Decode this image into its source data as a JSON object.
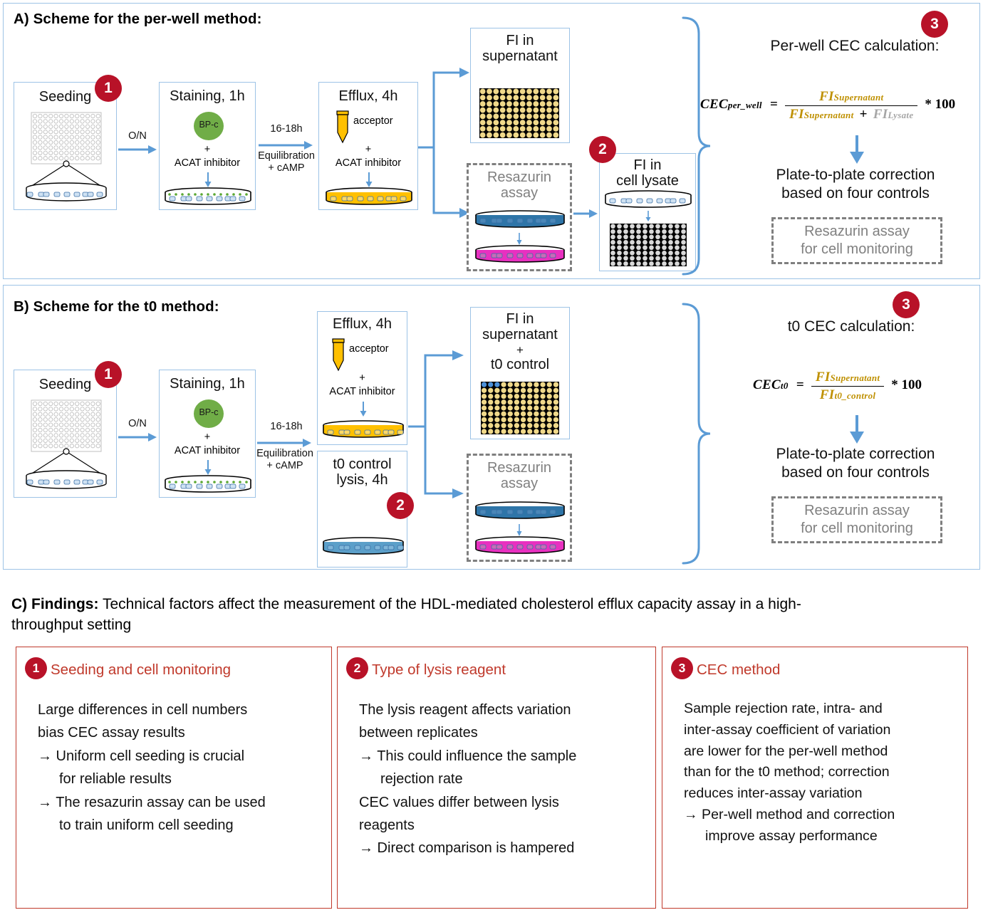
{
  "panelA": {
    "title": "A) Scheme for the per-well method:",
    "badges": {
      "one": "1",
      "two": "2",
      "three": "3"
    },
    "steps": [
      {
        "label": "Seeding",
        "icon": "96-well-plate-and-dish"
      },
      {
        "label": "Staining, 1h",
        "reagent": "BP-c",
        "plus": "+",
        "inhibitor": "ACAT inhibitor"
      },
      {
        "label": "Efflux, 4h",
        "reagent": "acceptor",
        "plus": "+",
        "inhibitor": "ACAT inhibitor"
      }
    ],
    "arrows": [
      {
        "label": "O/N"
      },
      {
        "label_line1": "16-18h",
        "label_line2": "Equilibration",
        "label_line3": "+ cAMP"
      }
    ],
    "outputs": [
      {
        "label_line1": "FI in",
        "label_line2": "supernatant",
        "icon": "yellow-microplate"
      },
      {
        "label_line1": "Resazurin",
        "label_line2": "assay",
        "style": "dashed-gray"
      },
      {
        "label_line1": "FI in",
        "label_line2": "cell lysate",
        "icon": "gray-microplate"
      }
    ],
    "calc": {
      "title": "Per-well CEC calculation:",
      "lhs": "CEC",
      "lhs_sub": "per_well",
      "eq": "=",
      "numerator": "FI",
      "numerator_sub": "Supernatant",
      "denominator_a": "FI",
      "denominator_a_sub": "Supernatant",
      "denominator_plus": "+",
      "denominator_b": "FI",
      "denominator_b_sub": "Lysate",
      "multiplier": "* 100"
    },
    "correction_line1": "Plate-to-plate correction",
    "correction_line2": "based on four controls",
    "resazurin_note_line1": "Resazurin assay",
    "resazurin_note_line2": "for cell monitoring"
  },
  "panelB": {
    "title": "B) Scheme for the t0 method:",
    "badges": {
      "one": "1",
      "two": "2",
      "three": "3"
    },
    "steps": [
      {
        "label": "Seeding",
        "icon": "96-well-plate-and-dish"
      },
      {
        "label": "Staining, 1h",
        "reagent": "BP-c",
        "plus": "+",
        "inhibitor": "ACAT inhibitor"
      },
      {
        "label": "Efflux, 4h",
        "reagent": "acceptor",
        "plus": "+",
        "inhibitor": "ACAT inhibitor"
      },
      {
        "label_line1": "t0 control",
        "label_line2": "lysis, 4h"
      }
    ],
    "arrows": [
      {
        "label": "O/N"
      },
      {
        "label_line1": "16-18h",
        "label_line2": "Equilibration",
        "label_line3": "+ cAMP"
      }
    ],
    "outputs": [
      {
        "label_line1": "FI in",
        "label_line2": "supernatant",
        "label_line3": "+",
        "label_line4": "t0 control",
        "icon": "yellow-microplate-with-blue"
      },
      {
        "label_line1": "Resazurin",
        "label_line2": "assay",
        "style": "dashed-gray"
      }
    ],
    "calc": {
      "title": "t0 CEC calculation:",
      "lhs": "CEC",
      "lhs_sub": "t0",
      "eq": "=",
      "numerator": "FI",
      "numerator_sub": "Supernatant",
      "denominator": "FI",
      "denominator_sub": "t0_control",
      "multiplier": "* 100"
    },
    "correction_line1": "Plate-to-plate correction",
    "correction_line2": "based on four controls",
    "resazurin_note_line1": "Resazurin assay",
    "resazurin_note_line2": "for cell monitoring"
  },
  "findings": {
    "prefix": "C) Findings:",
    "headline_line1": "Technical factors affect the measurement of the HDL-mediated cholesterol efflux capacity assay in a high-",
    "headline_line2": "throughput setting",
    "boxes": [
      {
        "number": "1",
        "title": "Seeding and cell monitoring",
        "lines": [
          {
            "text": "Large differences in cell numbers",
            "indent": false
          },
          {
            "text": "bias CEC assay results",
            "indent": false
          },
          {
            "text": "→ Uniform cell seeding is crucial",
            "indent": false
          },
          {
            "text": "for reliable results",
            "indent": true
          },
          {
            "text": "→ The resazurin assay can be used",
            "indent": false
          },
          {
            "text": "to train uniform cell seeding",
            "indent": true
          }
        ]
      },
      {
        "number": "2",
        "title": "Type of lysis reagent",
        "lines": [
          {
            "text": "The lysis reagent affects variation",
            "indent": false
          },
          {
            "text": "between replicates",
            "indent": false
          },
          {
            "text": "→ This could influence the sample",
            "indent": false
          },
          {
            "text": "rejection rate",
            "indent": true
          },
          {
            "text": "CEC values differ between lysis",
            "indent": false
          },
          {
            "text": "reagents",
            "indent": false
          },
          {
            "text": "→ Direct comparison is hampered",
            "indent": false
          }
        ]
      },
      {
        "number": "3",
        "title": "CEC method",
        "lines": [
          {
            "text": "Sample rejection rate, intra- and",
            "indent": false
          },
          {
            "text": "inter-assay coefficient of variation",
            "indent": false
          },
          {
            "text": "are lower for the per-well method",
            "indent": false
          },
          {
            "text": "than for the t0 method; correction",
            "indent": false
          },
          {
            "text": "reduces inter-assay variation",
            "indent": false
          },
          {
            "text": "→ Per-well method and correction",
            "indent": false
          },
          {
            "text": "improve assay performance",
            "indent": true
          }
        ]
      }
    ]
  },
  "colors": {
    "badge_red": "#b81228",
    "panel_border": "#9dc3e6",
    "arrow_blue": "#5b9bd5",
    "findings_border": "#c0392b",
    "findings_title": "#c0392b",
    "gray_dashed": "#7f7f7f",
    "acceptor_yellow": "#ffc000",
    "bpc_green": "#70ad47",
    "resazurin_blue": "#2e75a8",
    "resazurin_pink": "#e830c0",
    "formula_gold": "#bf9000",
    "formula_gray": "#a6a6a6"
  }
}
